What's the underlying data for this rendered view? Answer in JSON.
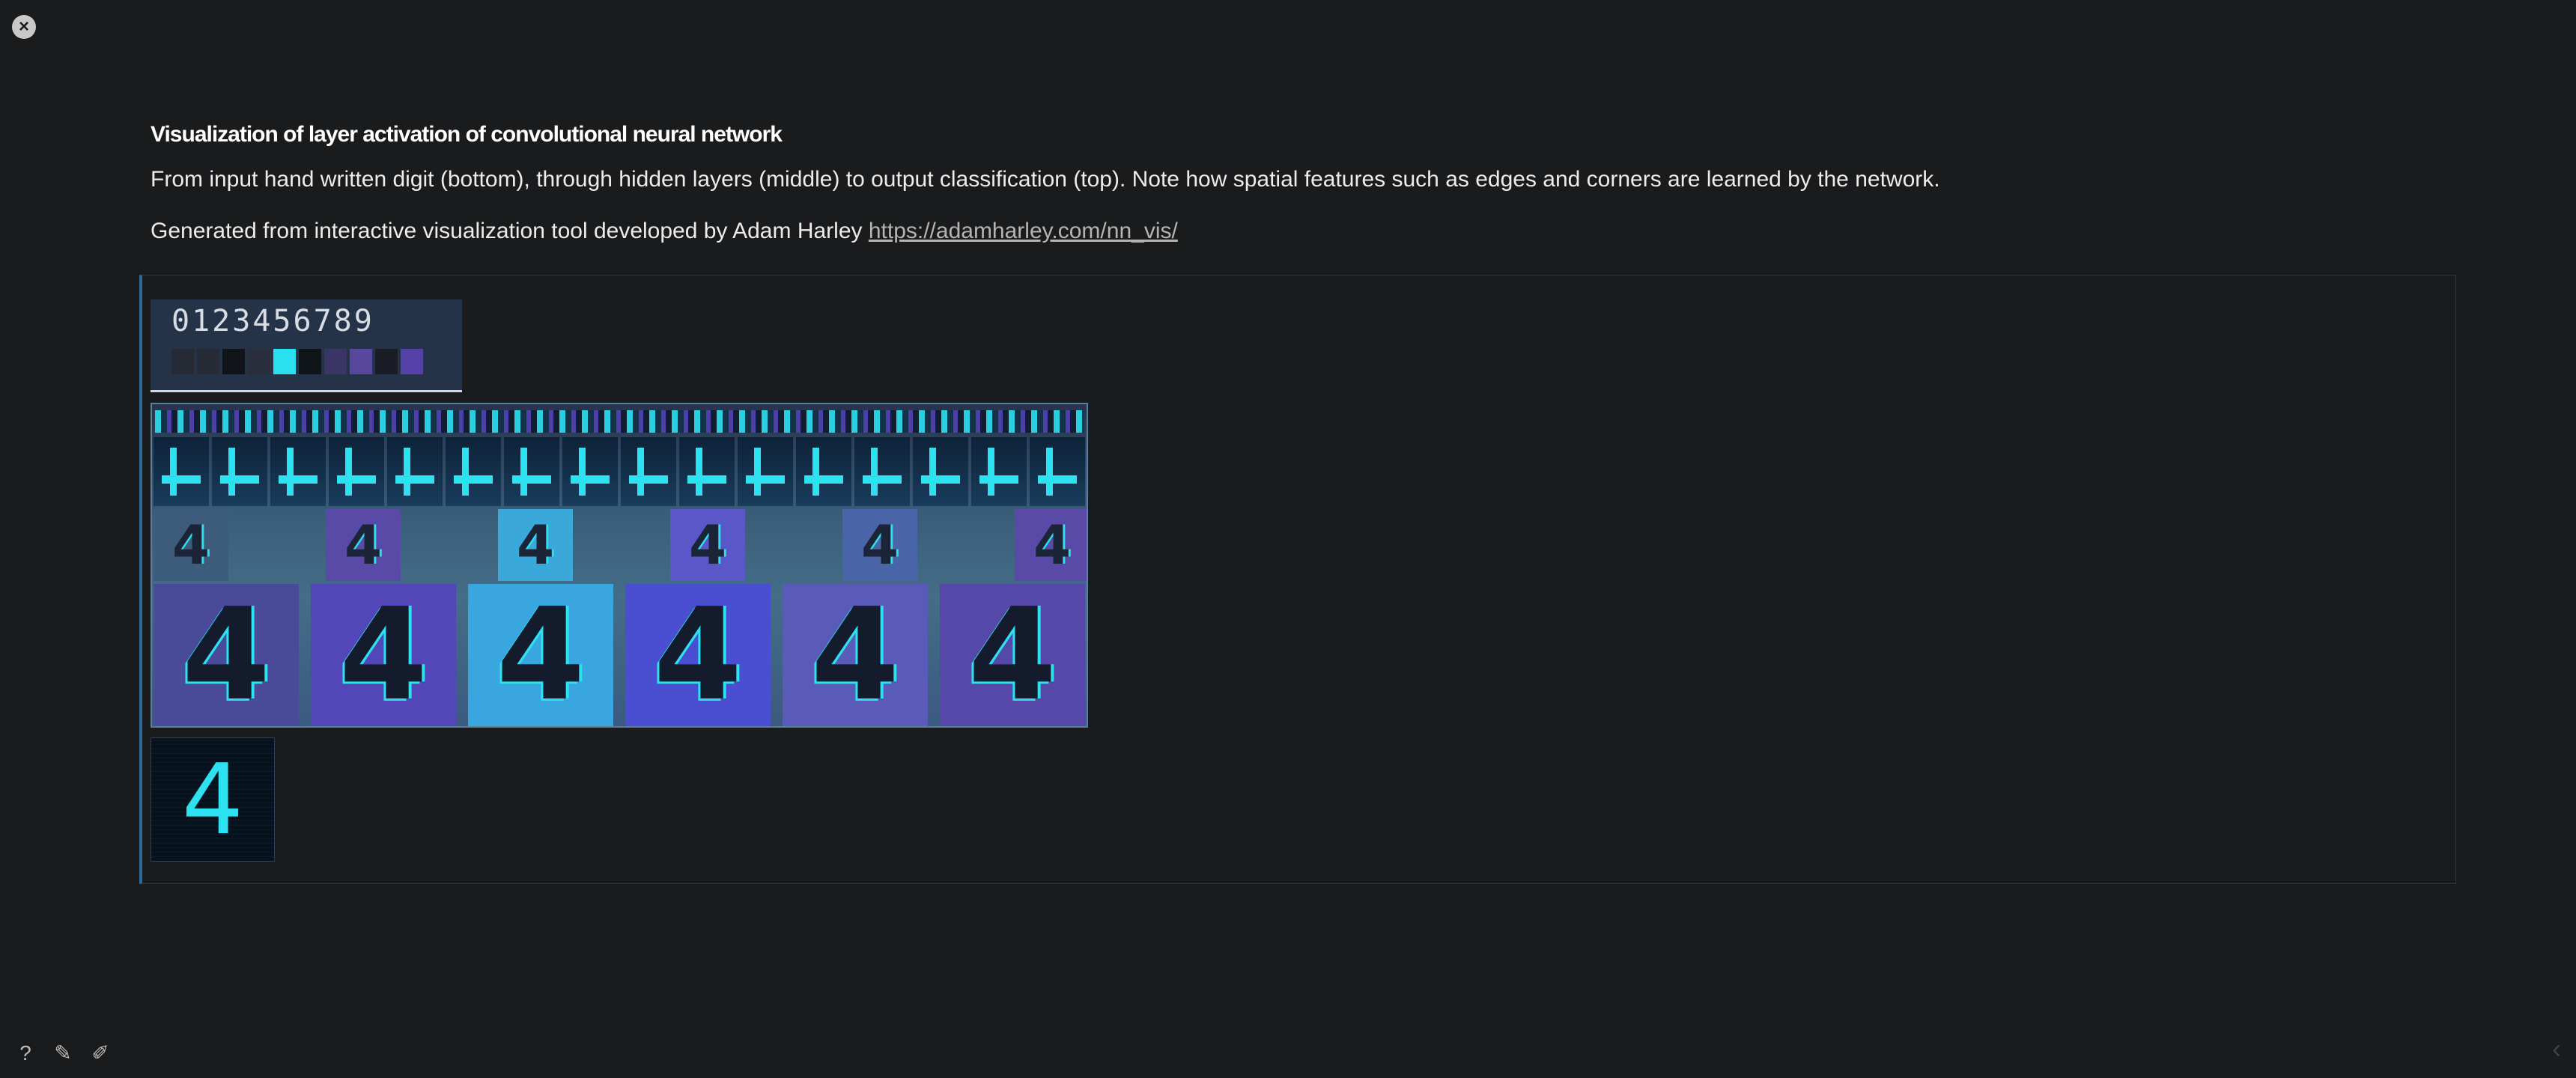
{
  "slide": {
    "title": "Visualization of layer activation of convolutional neural network",
    "paragraph_1": "From input hand written digit (bottom), through hidden layers (middle) to output classification (top). Note how spatial features such as edges and corners are learned by the network.",
    "paragraph_2_prefix": "Generated from interactive visualization tool developed by Adam Harley ",
    "link_text": "https://adamharley.com/nn_vis/"
  },
  "visualization": {
    "output_digits": "0123456789",
    "output_activation_colors": [
      "#252a35",
      "#262b36",
      "#101418",
      "#2a2d3c",
      "#2ae0ef",
      "#0f1419",
      "#3b3566",
      "#57479d",
      "#1a1d25",
      "#5442a8"
    ],
    "input_digit": "4",
    "feature_map_glyph": "4"
  },
  "toolbar": {
    "close_icon": "×",
    "help_icon": "?",
    "edit_icon": "✎",
    "pencil_icon": "✐",
    "prev_icon": "‹"
  },
  "colors": {
    "background": "#1a1b1d",
    "accent_cyan": "#2ae0ef",
    "accent_purple": "#5442a8"
  }
}
